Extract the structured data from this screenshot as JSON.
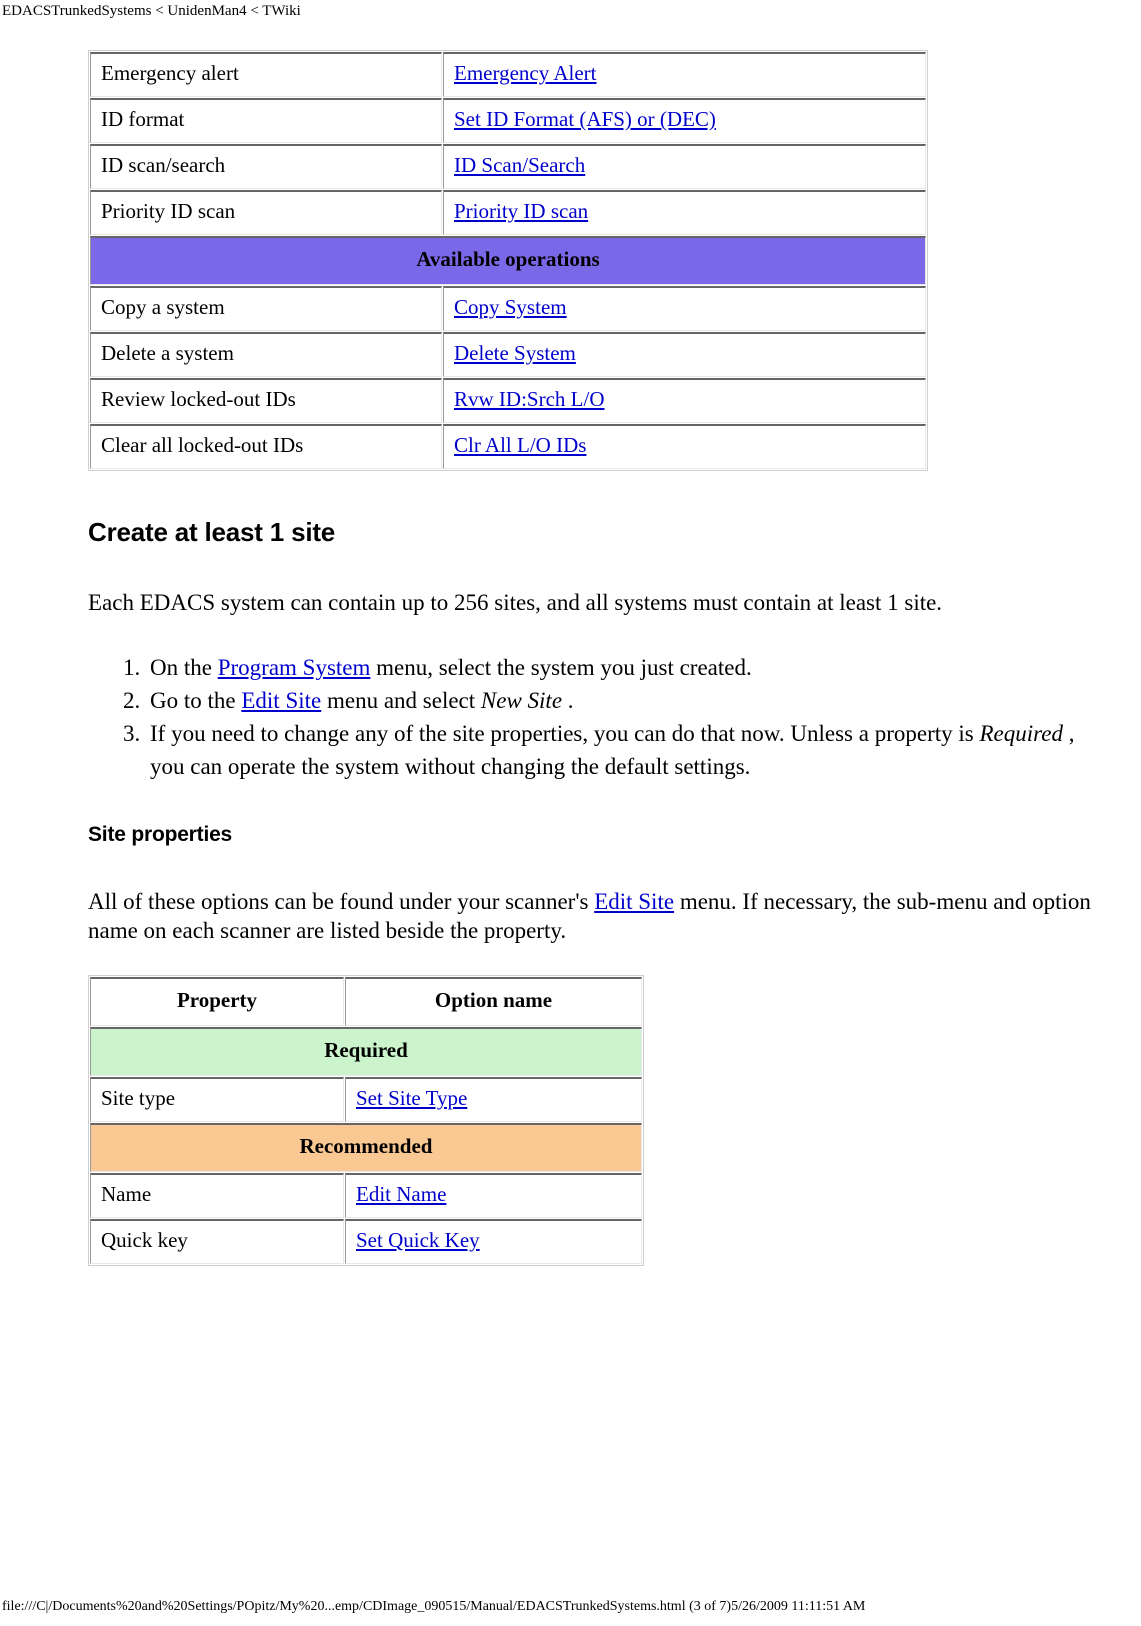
{
  "page": {
    "header_breadcrumb": "EDACSTrunkedSystems < UnidenMan4 < TWiki",
    "footer_path": "file:///C|/Documents%20and%20Settings/POpitz/My%20...emp/CDImage_090515/Manual/EDACSTrunkedSystems.html (3 of 7)5/26/2009 11:11:51 AM"
  },
  "colors": {
    "link": "#0000cc",
    "section_purple": "#7b68e8",
    "required_green": "#ccf4cc",
    "recommended_orange": "#fac893",
    "cell_border_dark": "#666666",
    "table_outer": "#cfcfcf"
  },
  "tables": {
    "operations": {
      "rows": [
        {
          "kind": "data",
          "property": "Emergency alert",
          "option": "Emergency Alert"
        },
        {
          "kind": "data",
          "property": "ID format",
          "option": "Set ID Format (AFS) or (DEC)"
        },
        {
          "kind": "data",
          "property": "ID scan/search",
          "option": "ID Scan/Search"
        },
        {
          "kind": "data",
          "property": "Priority ID scan",
          "option": "Priority ID scan"
        },
        {
          "kind": "section",
          "label": "Available operations",
          "style": "purple"
        },
        {
          "kind": "data",
          "property": "Copy a system",
          "option": "Copy System"
        },
        {
          "kind": "data",
          "property": "Delete a system",
          "option": "Delete System"
        },
        {
          "kind": "data",
          "property": "Review locked-out IDs",
          "option": "Rvw ID:Srch L/O"
        },
        {
          "kind": "data",
          "property": "Clear all locked-out IDs",
          "option": "Clr All L/O IDs"
        }
      ]
    },
    "site_properties": {
      "headers": {
        "col1": "Property",
        "col2": "Option name"
      },
      "rows": [
        {
          "kind": "section",
          "label": "Required",
          "style": "green"
        },
        {
          "kind": "data",
          "property": "Site type",
          "option": "Set Site Type"
        },
        {
          "kind": "section",
          "label": "Recommended",
          "style": "orange"
        },
        {
          "kind": "data",
          "property": "Name",
          "option": "Edit Name"
        },
        {
          "kind": "data",
          "property": "Quick key",
          "option": "Set Quick Key"
        }
      ]
    }
  },
  "sections": {
    "create_site": {
      "heading": "Create at least 1 site",
      "intro": "Each EDACS system can contain up to 256 sites, and all systems must contain at least 1 site.",
      "steps": [
        {
          "pre": "On the ",
          "link": "Program System",
          "post": " menu, select the system you just created."
        },
        {
          "pre": "Go to the ",
          "link": "Edit Site",
          "post": " menu and select ",
          "italic": "New Site",
          "tail": " ."
        },
        {
          "pre": "If you need to change any of the site properties, you can do that now. Unless a property is ",
          "italic": "Required",
          "tail": " , you can operate the system without changing the default settings."
        }
      ]
    },
    "site_properties": {
      "heading": "Site properties",
      "intro_pre": "All of these options can be found under your scanner's ",
      "intro_link": "Edit Site",
      "intro_post": " menu. If necessary, the sub-menu and option name on each scanner are listed beside the property."
    }
  }
}
